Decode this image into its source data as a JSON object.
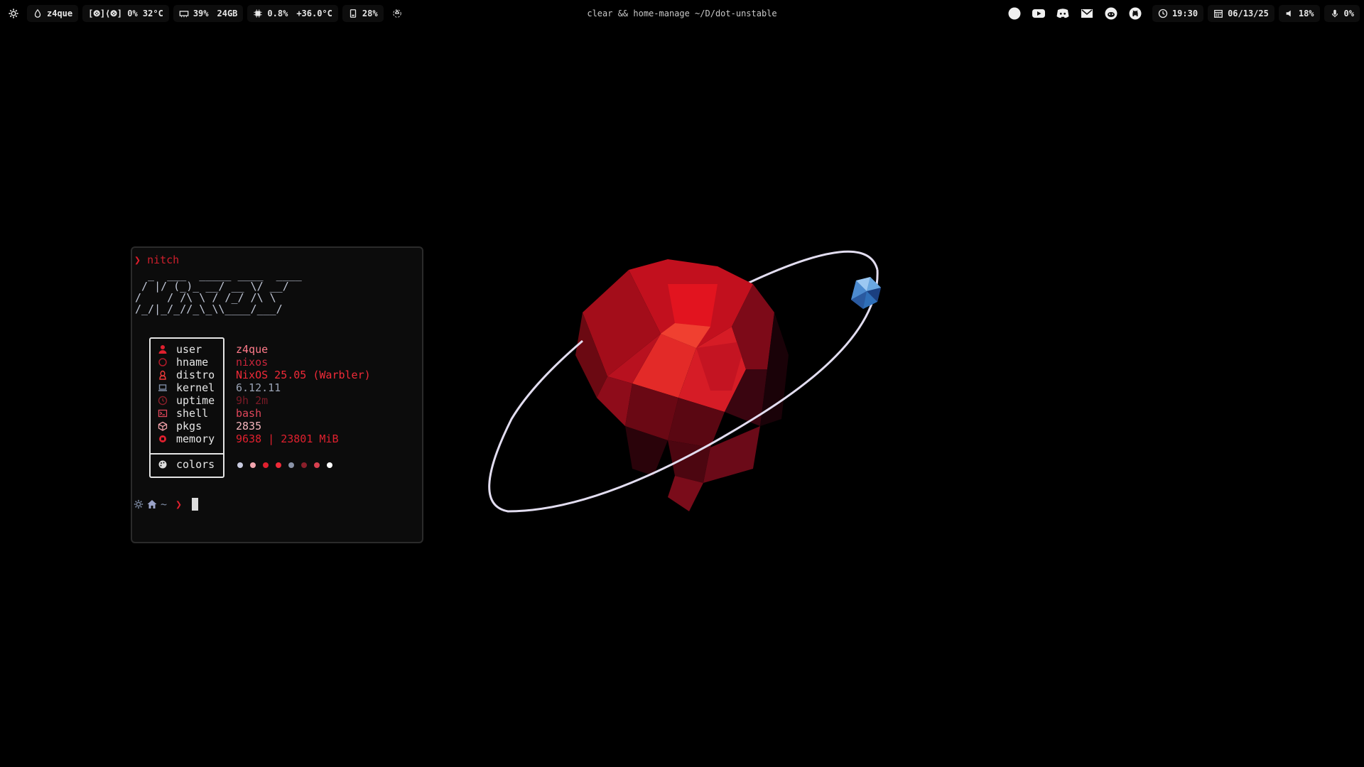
{
  "bar": {
    "left": {
      "user": "z4que",
      "cpu": "[⨷]⟨⨷] 0% 32°C",
      "mem_pct": "39%",
      "mem_total": "24GB",
      "gpu_usage": "0.8%",
      "gpu_temp": "+36.0°C",
      "disk": "28%"
    },
    "center_title": "clear && home-manage ~/D/dot-unstable",
    "right": {
      "clock": "19:30",
      "date": "06/13/25",
      "volume": "18%",
      "mic": "0%"
    },
    "app_icons": [
      "browser-icon",
      "youtube-icon",
      "discord-icon",
      "mail-icon",
      "reddit-icon",
      "github-icon"
    ]
  },
  "terminal": {
    "command_prompt_symbol": "❯",
    "command": "nitch",
    "ascii_art": "  _  ___  _____ ____  ____\n / |/ (_)_ __/ __ \\/ __/\n/    / /\\ \\ / /_/ /\\ \\\n/_/|_/_//_\\_\\\\____/___/",
    "info": [
      {
        "label": "user",
        "value": "z4que",
        "icon": "user-icon",
        "icon_color": "#e0202e",
        "value_color": "#ff7b8a"
      },
      {
        "label": "hname",
        "value": "nixos",
        "icon": "circle-icon",
        "icon_color": "#b01a28",
        "value_color": "#c8243a"
      },
      {
        "label": "distro",
        "value": "NixOS 25.05 (Warbler)",
        "icon": "linux-icon",
        "icon_color": "#f03a3a",
        "value_color": "#f02a38"
      },
      {
        "label": "kernel",
        "value": "6.12.11",
        "icon": "laptop-icon",
        "icon_color": "#7d8aa3",
        "value_color": "#9aa3b5"
      },
      {
        "label": "uptime",
        "value": "9h 2m",
        "icon": "clock-icon",
        "icon_color": "#8a1f2a",
        "value_color": "#7a1a26"
      },
      {
        "label": "shell",
        "value": "bash",
        "icon": "terminal-icon",
        "icon_color": "#e0465a",
        "value_color": "#e0465a"
      },
      {
        "label": "pkgs",
        "value": "2835",
        "icon": "package-icon",
        "icon_color": "#f0a0a8",
        "value_color": "#f4b6bd"
      },
      {
        "label": "memory",
        "value": "9638 | 23801 MiB",
        "icon": "chip-icon",
        "icon_color": "#e0202e",
        "value_color": "#e0202e"
      }
    ],
    "colors_label": "colors",
    "color_dots": [
      "#c9cbe0",
      "#f2a5ae",
      "#e0202e",
      "#f02a38",
      "#8a93a8",
      "#8a1f2a",
      "#d8404f",
      "#ffffff"
    ],
    "prompt_path": "~",
    "prompt_symbol": "❯"
  }
}
